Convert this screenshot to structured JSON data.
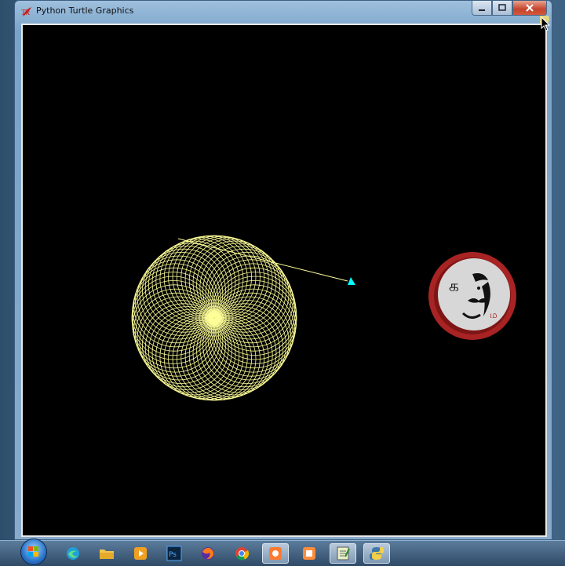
{
  "window": {
    "title": "Python Turtle Graphics",
    "app_icon": "tk-feather-icon",
    "controls": [
      "minimize-icon",
      "maximize-icon",
      "close-icon"
    ]
  },
  "canvas": {
    "background": "#000000",
    "pattern_color": "#ffff99",
    "turtle_color": "#00ffff",
    "pattern": "spirograph ring of overlapping circles"
  },
  "overlay_logo": {
    "ring_color": "#b52a2a",
    "face_color": "#d9d9d9"
  },
  "taskbar": {
    "items": [
      "start-orb-icon",
      "edge-icon",
      "file-explorer-icon",
      "media-player-icon",
      "photoshop-icon",
      "firefox-icon",
      "chrome-icon",
      "app-orange-icon",
      "app-orange2-icon",
      "notepad-icon",
      "python-icon"
    ]
  }
}
